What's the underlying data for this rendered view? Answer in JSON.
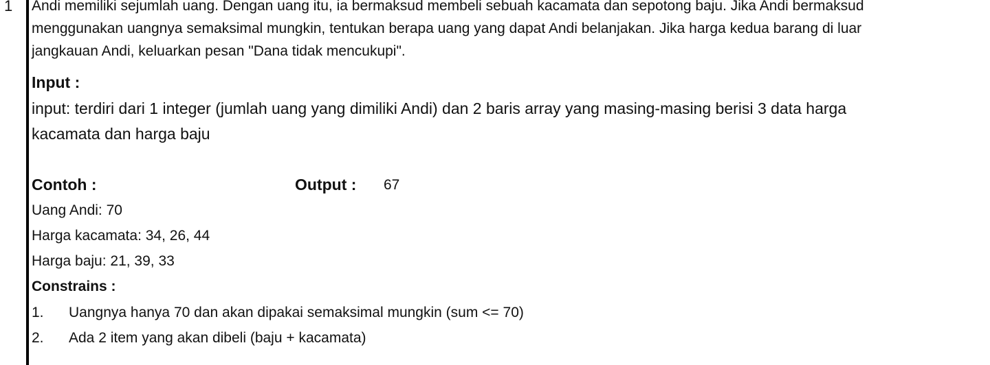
{
  "row_number": "1",
  "description": [
    "Andi memiliki sejumlah uang. Dengan uang itu, ia bermaksud membeli sebuah kacamata dan sepotong baju. Jika Andi bermaksud",
    "menggunakan uangnya semaksimal mungkin, tentukan berapa uang yang dapat Andi belanjakan. Jika harga kedua barang di luar",
    "jangkauan Andi, keluarkan pesan \"Dana tidak mencukupi\"."
  ],
  "input_heading": "Input :",
  "input_text": [
    "input: terdiri dari 1 integer (jumlah uang yang dimiliki Andi) dan 2 baris array yang masing-masing berisi 3 data harga",
    "kacamata dan harga baju"
  ],
  "example": {
    "heading": "Contoh :",
    "output_label": "Output :",
    "output_value": "67",
    "lines": [
      "Uang Andi: 70",
      "Harga kacamata: 34, 26, 44",
      "Harga baju: 21, 39, 33"
    ]
  },
  "constraints": {
    "heading": "Constrains :",
    "items": [
      {
        "num": "1.",
        "text": "Uangnya hanya 70 dan akan dipakai semaksimal mungkin (sum <= 70)"
      },
      {
        "num": "2.",
        "text": "Ada 2 item yang akan dibeli (baju + kacamata)"
      }
    ]
  }
}
